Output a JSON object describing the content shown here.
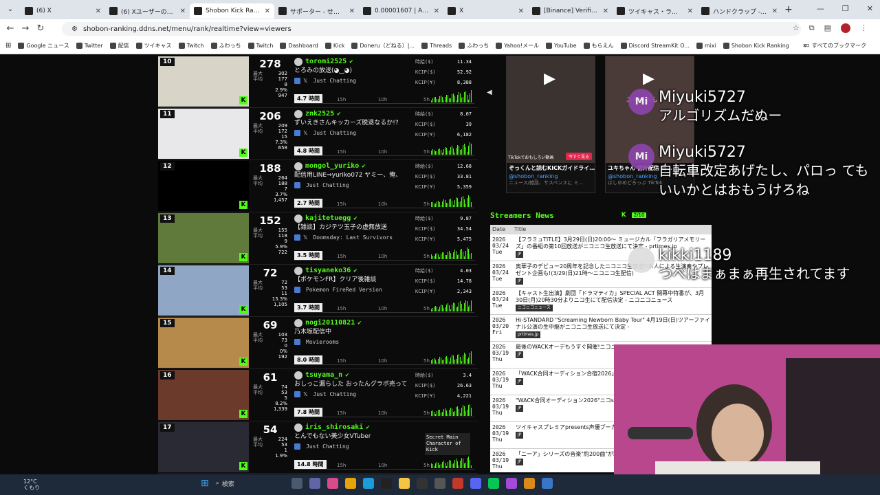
{
  "tabs": [
    {
      "title": "(6) X",
      "active": false
    },
    {
      "title": "(6) Xユーザーのくにお様",
      "active": false
    },
    {
      "title": "Shobon Kick Ranking",
      "active": true
    },
    {
      "title": "サポーター - せんちょさん",
      "active": false
    },
    {
      "title": "0.00001607 | AXS BTC",
      "active": false
    },
    {
      "title": "X",
      "active": false
    },
    {
      "title": "[Binance] Verification",
      "active": false
    },
    {
      "title": "ツイキャス・ライブでつな",
      "active": false
    },
    {
      "title": "ハンドクラップ - Google",
      "active": false
    }
  ],
  "address": {
    "url": "shobon-ranking.ddns.net/menu/rank/realtime?view=viewers"
  },
  "bookmarks": [
    "Google ニュース",
    "Twitter",
    "配信",
    "ツイキャス",
    "Twitch",
    "ふわっち",
    "Twitch",
    "Dashboard",
    "Kick",
    "Doneru（どねる）|...",
    "Threads",
    "ふわっち",
    "Yahoo!メール",
    "YouTube",
    "もらえん",
    "Discord StreamKit O...",
    "mixi",
    "Shobon Kick Ranking"
  ],
  "bookmarks_folder": "すべてのブックマーク",
  "labels": {
    "max": "最大",
    "avg": "平均",
    "hourly": "時給($)",
    "kcip_usd": "KCIP($)",
    "kcip_yen": "KCIP(¥)",
    "t15": "15h",
    "t10": "10h",
    "t5": "5h"
  },
  "streamers": [
    {
      "rank": "10",
      "viewers": "278",
      "max": "302",
      "avg": "177",
      "s1": "8",
      "pct": "2.9%",
      "total": "947",
      "name": "toromi2525",
      "title": "とろみの放送(◕‿◕)",
      "category": "Just Chatting",
      "hours": "4.7 時間",
      "hourly": "11.34",
      "kcip_usd": "52.92",
      "kcip_yen": "8,388",
      "thumb": "#d9d4c8",
      "socials": true
    },
    {
      "rank": "11",
      "viewers": "206",
      "max": "209",
      "avg": "172",
      "s1": "15",
      "pct": "7.3%",
      "total": "658",
      "name": "znk2525",
      "title": "ずいえきさんキッカーズ脱退なるか!?",
      "category": "Just Chatting",
      "hours": "4.8 時間",
      "hourly": "8.07",
      "kcip_usd": "39",
      "kcip_yen": "6,182",
      "thumb": "#e8e8ea",
      "socials": true
    },
    {
      "rank": "12",
      "viewers": "188",
      "max": "264",
      "avg": "188",
      "s1": "7",
      "pct": "3.7%",
      "total": "1,457",
      "name": "mongol_yuriko",
      "title": "配信用LINE⇒yuriko072 ヤミー、俺、",
      "category": "Just Chatting",
      "hours": "2.7 時間",
      "hourly": "12.68",
      "kcip_usd": "33.81",
      "kcip_yen": "5,359",
      "thumb": "#000000",
      "socials": false
    },
    {
      "rank": "13",
      "viewers": "152",
      "max": "155",
      "avg": "118",
      "s1": "9",
      "pct": "5.9%",
      "total": "722",
      "name": "kajitetuegg",
      "title": "【雑談】カジテツ玉子の虚無放送",
      "category": "Doomsday: Last Survivors",
      "hours": "3.5 時間",
      "hourly": "9.87",
      "kcip_usd": "34.54",
      "kcip_yen": "5,475",
      "thumb": "#5f7a3a",
      "socials": true
    },
    {
      "rank": "14",
      "viewers": "72",
      "max": "72",
      "avg": "53",
      "s1": "11",
      "pct": "15.3%",
      "total": "1,105",
      "name": "tisyaneko36",
      "title": "【ポケモンFR】クリア後雑談",
      "category": "Pokemon FireRed Version",
      "hours": "3.7 時間",
      "hourly": "4.03",
      "kcip_usd": "14.78",
      "kcip_yen": "2,343",
      "thumb": "#8fa7c4",
      "socials": false
    },
    {
      "rank": "15",
      "viewers": "69",
      "max": "103",
      "avg": "73",
      "s1": "0",
      "pct": "0%",
      "total": "192",
      "name": "nogi20110821",
      "title": "乃木坂配信中",
      "category": "Movierooms",
      "hours": "8.0 時間",
      "hourly": "",
      "kcip_usd": "",
      "kcip_yen": "",
      "thumb": "#b58a4a",
      "socials": false
    },
    {
      "rank": "16",
      "viewers": "61",
      "max": "74",
      "avg": "53",
      "s1": "5",
      "pct": "8.2%",
      "total": "1,339",
      "name": "tsuyama_n",
      "title": "おしっこ漏らした おったんグラボ売って",
      "category": "Just Chatting",
      "hours": "7.8 時間",
      "hourly": "3.4",
      "kcip_usd": "26.63",
      "kcip_yen": "4,221",
      "thumb": "#6b3a2a",
      "socials": true
    },
    {
      "rank": "17",
      "viewers": "54",
      "max": "224",
      "avg": "53",
      "s1": "1",
      "pct": "1.9%",
      "total": "",
      "name": "iris_shirosaki",
      "title": "とんでもない美少女VTuber",
      "category": "Just Chatting",
      "hours": "14.8 時間",
      "hourly": "",
      "kcip_usd": "",
      "kcip_yen": "",
      "thumb": "#2a2a34",
      "socials": false
    }
  ],
  "ad_text": "Secret Main Character of Kick",
  "videos": [
    {
      "title": "ぞっくんと読むKICKガイドライ…",
      "channel": "@shobon_ranking",
      "meta": "ニュース/雑談、サスペンスに ミ…",
      "promo": "今すぐ見る",
      "promo_caption": "TikTokでおもしろい動画",
      "color": "#3a3330"
    },
    {
      "title": "ユキちゃん 初外配信 日…",
      "channel": "@shobon_ranking",
      "meta": "ほしゆめどろっぷ TikTok",
      "promo": "",
      "promo_caption": "",
      "color": "#4a3a38"
    }
  ],
  "news": {
    "heading": "Streamers News",
    "counter": "2/10",
    "col_date": "Date",
    "col_title": "Title",
    "items": [
      {
        "date": "2026\n03/24\nTue",
        "title": "【フラミュTITLE】3月29日(日)20:00〜 ミュージカル「フラガリアメモリーズ」の番組の第10回放送がニコニコ生放送にて決定 - prtimes.jp",
        "source": "JP"
      },
      {
        "date": "2026\n03/24\nTue",
        "title": "奥華子のデビュー20周年を記念したニコニコ生放送!!本人による生演奏やプレゼント企画も!(3/29(日)21時〜ニコニコ生配信)",
        "source": "JP"
      },
      {
        "date": "2026\n03/24\nTue",
        "title": "【キャスト生出演】劇団「ドラマティカ」SPECIAL ACT 開幕中特番が、3月30日(月)20時30分よりニコ生にて配信決定 - ニコニコニュース",
        "source": "ニコニコニュース"
      },
      {
        "date": "2026\n03/20\nFri",
        "title": "Hi-STANDARD \"Screaming Newborn Baby Tour\" 4月19日(日)ツアーファイナル公演の生中継がニコニコ生放送にて決定 -",
        "source": "prtimes.jp"
      },
      {
        "date": "2026\n03/19\nThu",
        "title": "最後のWACKオーデもうすぐ開催!ニコニコニュース",
        "source": "JP"
      },
      {
        "date": "2026\n03/19\nThu",
        "title": "「WACK合同オーディション合宿2026」(日)13:00から全編生中継決定。",
        "source": "JP"
      },
      {
        "date": "2026\n03/19\nThu",
        "title": "\"WACK合同オーディション2026\"ニコskream.jp",
        "source": "JP"
      },
      {
        "date": "2026\n03/19\nThu",
        "title": "ツイキャスプレミアpresents声優ブーカイブ配信中 - 文化放送",
        "source": "JP"
      },
      {
        "date": "2026\n03/19\nThu",
        "title": "「ニーア」シリーズの音楽\"約200曲\"が利用可能に - 電ファミニコゲーマー",
        "source": "JP"
      }
    ]
  },
  "chat": [
    {
      "avatar": "Mi",
      "name": "Miyuki5727",
      "text": "アルゴリズムだぬー"
    },
    {
      "avatar": "Mi",
      "name": "Miyuki5727",
      "text": "自転車改定あげたし、パロっ てもいいかとはおもうけろね"
    },
    {
      "avatar": "",
      "name": "kikki1189",
      "text": "つべはまぁまぁ再生されてます"
    }
  ],
  "video_watermark": "ユキちゃん",
  "taskbar": {
    "temp": "12°C",
    "weather": "くもり",
    "search": "検索"
  },
  "colors": {
    "kick_green": "#53fc18",
    "page_bg": "#0b0b0b",
    "chat_avatar": "#8e44ad",
    "cam_bg": "#c04b95"
  }
}
